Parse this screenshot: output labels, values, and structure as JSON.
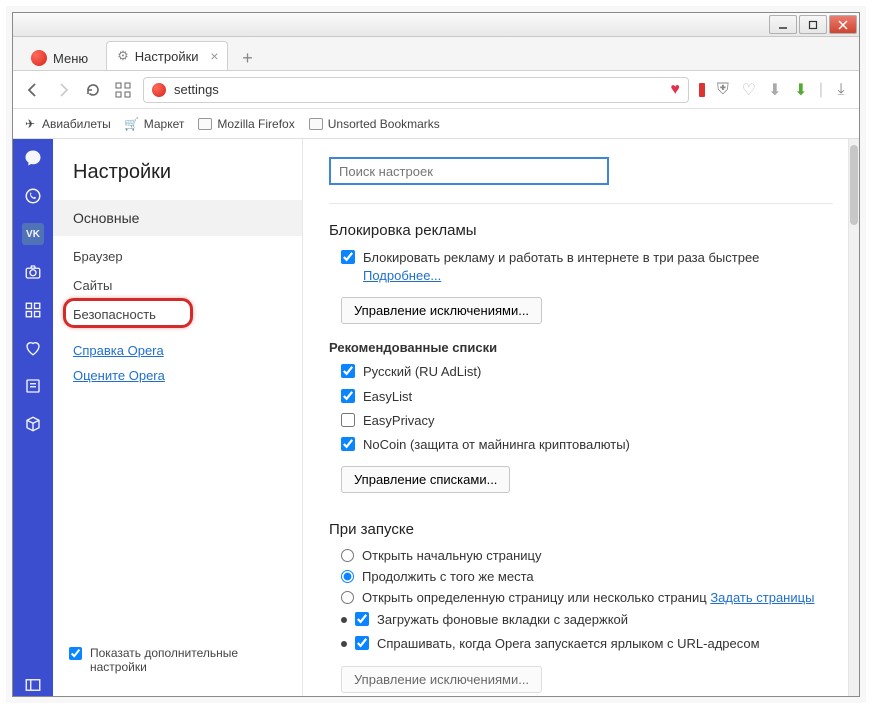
{
  "window": {
    "menu_label": "Меню"
  },
  "tab": {
    "title": "Настройки"
  },
  "address": {
    "value": "settings"
  },
  "bookmarks": {
    "items": [
      {
        "label": "Авиабилеты"
      },
      {
        "label": "Маркет"
      },
      {
        "label": "Mozilla Firefox"
      },
      {
        "label": "Unsorted Bookmarks"
      }
    ]
  },
  "settings": {
    "title": "Настройки",
    "nav": {
      "main": "Основные",
      "browser": "Браузер",
      "sites": "Сайты",
      "security": "Безопасность"
    },
    "links": {
      "help": "Справка Opera",
      "rate": "Оцените Opera"
    },
    "advanced_label": "Показать дополнительные настройки",
    "search_placeholder": "Поиск настроек"
  },
  "sections": {
    "adblock": {
      "title": "Блокировка рекламы",
      "enable_label": "Блокировать рекламу и работать в интернете в три раза быстрее",
      "more_link": "Подробнее...",
      "manage_exceptions_btn": "Управление исключениями...",
      "rec_title": "Рекомендованные списки",
      "lists": {
        "ru": "Русский (RU AdList)",
        "easylist": "EasyList",
        "easyprivacy": "EasyPrivacy",
        "nocoin": "NoCoin (защита от майнинга криптовалюты)"
      },
      "manage_lists_btn": "Управление списками..."
    },
    "startup": {
      "title": "При запуске",
      "opt_start": "Открыть начальную страницу",
      "opt_continue": "Продолжить с того же места",
      "opt_specific": "Открыть определенную страницу или несколько страниц",
      "set_pages_link": "Задать страницы",
      "bg_tabs": "Загружать фоновые вкладки с задержкой",
      "ask_url": "Спрашивать, когда Opera запускается ярлыком с URL-адресом",
      "manage_exceptions_btn": "Управление исключениями..."
    }
  }
}
